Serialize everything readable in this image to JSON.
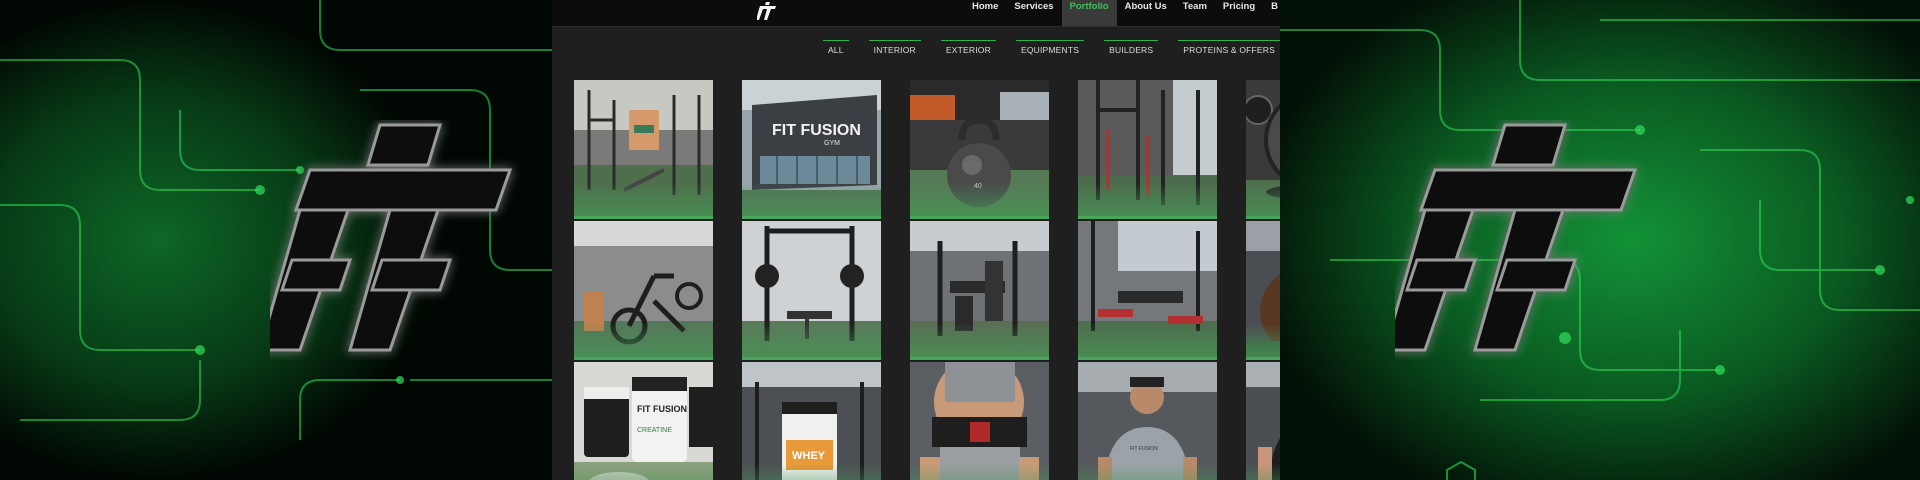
{
  "brand": {
    "logo_text": "FIT FUSION"
  },
  "nav": {
    "items": [
      {
        "label": "Home",
        "active": false
      },
      {
        "label": "Services",
        "active": false
      },
      {
        "label": "Portfolio",
        "active": true
      },
      {
        "label": "About Us",
        "active": false
      },
      {
        "label": "Team",
        "active": false
      },
      {
        "label": "Pricing",
        "active": false
      },
      {
        "label": "B",
        "active": false
      }
    ]
  },
  "filters": [
    "ALL",
    "INTERIOR",
    "EXTERIOR",
    "EQUIPMENTS",
    "BUILDERS",
    "PROTEINS & OFFERS"
  ],
  "gallery": {
    "tiles": [
      {
        "name": "gym-interior-racks-photo"
      },
      {
        "name": "gym-exterior-storefront-photo",
        "sign": "FIT FUSION",
        "sub": "GYM"
      },
      {
        "name": "kettlebell-photo",
        "kb_text": "40"
      },
      {
        "name": "power-rack-photo"
      },
      {
        "name": "weight-plate-photo"
      },
      {
        "name": "spin-bikes-photo"
      },
      {
        "name": "smith-machine-photo"
      },
      {
        "name": "weight-machines-photo"
      },
      {
        "name": "bench-press-area-photo"
      },
      {
        "name": "bodybuilder-photo"
      },
      {
        "name": "creatine-supplements-photo",
        "jar": "FIT FUSION",
        "jar_sub": "CREATINE"
      },
      {
        "name": "whey-protein-photo",
        "jar": "WHEY"
      },
      {
        "name": "lifting-belt-photo"
      },
      {
        "name": "trainer-man-photo"
      },
      {
        "name": "trainer-hoodie-photo"
      }
    ]
  },
  "colors": {
    "accent": "#3fbf5a",
    "site_bg": "#1f1f1f",
    "topbar_bg": "#0c0c0c",
    "background_green": "#0f6b26"
  }
}
